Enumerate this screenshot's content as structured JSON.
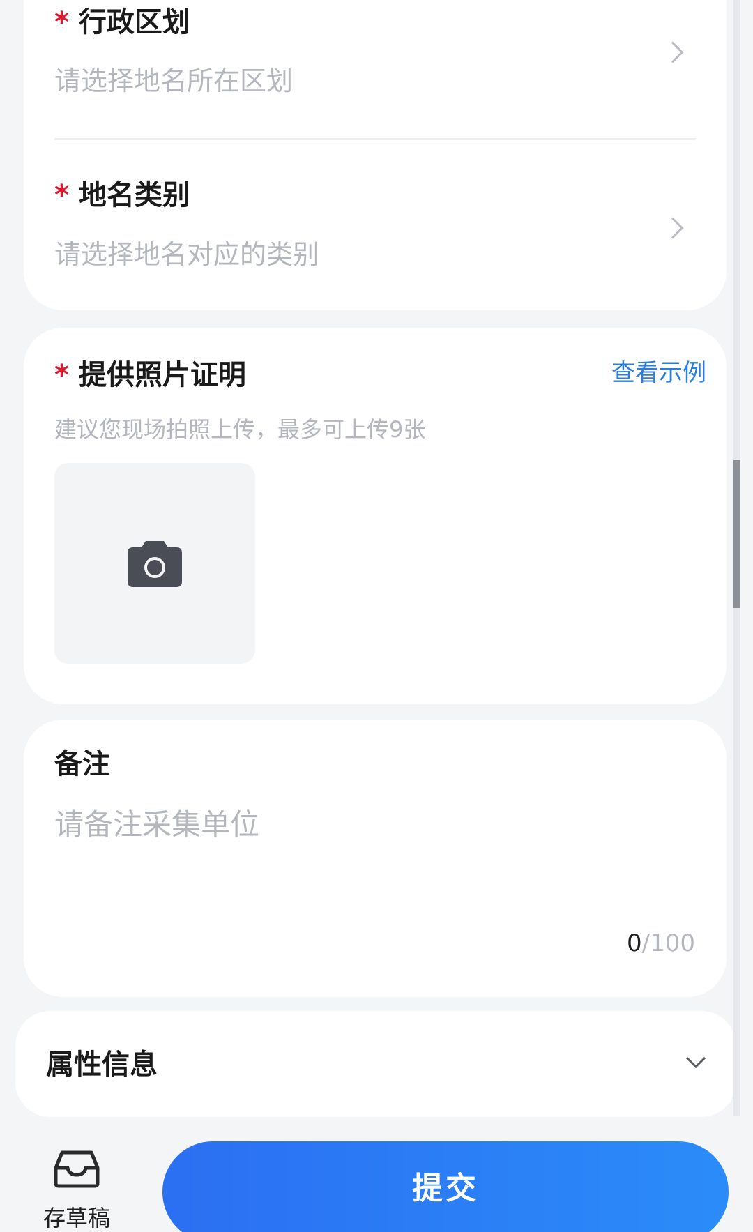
{
  "form": {
    "region": {
      "required_mark": "*",
      "label": "行政区划",
      "placeholder": "请选择地名所在区划"
    },
    "category": {
      "required_mark": "*",
      "label": "地名类别",
      "placeholder": "请选择地名对应的类别"
    },
    "photos": {
      "required_mark": "*",
      "label": "提供照片证明",
      "example_link": "查看示例",
      "hint": "建议您现场拍照上传，最多可上传9张",
      "upload_icon": "camera-icon"
    },
    "remark": {
      "label": "备注",
      "placeholder": "请备注采集单位",
      "count_current": "0",
      "count_max": "/100"
    },
    "attributes": {
      "label": "属性信息",
      "expand_icon": "chevron-down-icon"
    }
  },
  "footer": {
    "draft_label": "存草稿",
    "draft_icon": "inbox-icon",
    "submit_label": "提交"
  },
  "colors": {
    "required": "#e0182d",
    "link": "#2a7de1",
    "submit_start": "#2b6ff2",
    "submit_end": "#2b8cf9",
    "placeholder": "#b4b7bd"
  }
}
